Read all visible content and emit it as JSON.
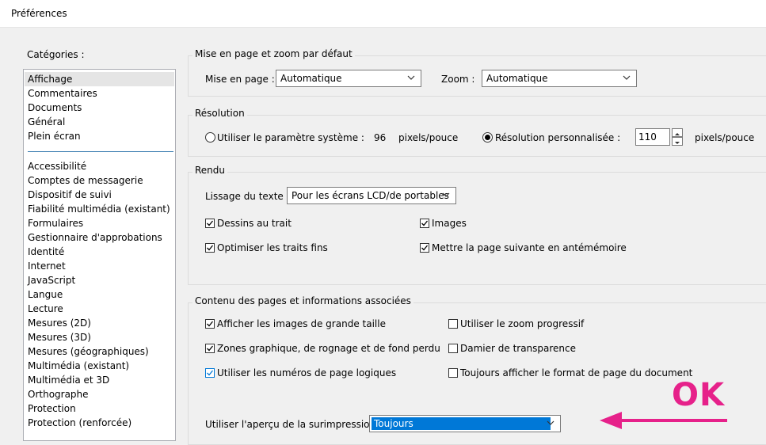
{
  "window": {
    "title": "Préférences"
  },
  "categories": {
    "label": "Catégories :",
    "top_items": [
      "Affichage",
      "Commentaires",
      "Documents",
      "Général",
      "Plein écran"
    ],
    "items": [
      "Accessibilité",
      "Comptes de messagerie",
      "Dispositif de suivi",
      "Fiabilité multimédia (existant)",
      "Formulaires",
      "Gestionnaire d'approbations",
      "Identité",
      "Internet",
      "JavaScript",
      "Langue",
      "Lecture",
      "Mesures (2D)",
      "Mesures (3D)",
      "Mesures (géographiques)",
      "Multimédia (existant)",
      "Multimédia et 3D",
      "Orthographe",
      "Protection",
      "Protection (renforcée)"
    ],
    "selected": "Affichage"
  },
  "layout_group": {
    "title": "Mise en page et zoom par défaut",
    "page_label": "Mise en page :",
    "page_value": "Automatique",
    "zoom_label": "Zoom :",
    "zoom_value": "Automatique"
  },
  "resolution": {
    "title": "Résolution",
    "system_label": "Utiliser le paramètre système :",
    "system_value": "96",
    "system_unit": "pixels/pouce",
    "custom_label": "Résolution personnalisée :",
    "custom_value": "110",
    "custom_unit": "pixels/pouce",
    "selected": "custom"
  },
  "rendering": {
    "title": "Rendu",
    "smoothing_label": "Lissage du texte :",
    "smoothing_value": "Pour les écrans LCD/de portables",
    "line_art": {
      "label": "Dessins au trait",
      "checked": true
    },
    "images": {
      "label": "Images",
      "checked": true
    },
    "thin_lines": {
      "label": "Optimiser les traits fins",
      "checked": true
    },
    "cache_page": {
      "label": "Mettre la page suivante en antémémoire",
      "checked": true
    }
  },
  "page_content": {
    "title": "Contenu des pages et informations associées",
    "large_images": {
      "label": "Afficher les images de grande taille",
      "checked": true
    },
    "smooth_zoom": {
      "label": "Utiliser le zoom progressif",
      "checked": false
    },
    "art_trim_bleed": {
      "label": "Zones graphique, de rognage et de fond perdu",
      "checked": true
    },
    "transparency_grid": {
      "label": "Damier de transparence",
      "checked": false
    },
    "logical_page_numbers": {
      "label": "Utiliser les numéros de page logiques",
      "checked": true
    },
    "always_doc_size": {
      "label": "Toujours afficher le format de page du document",
      "checked": false
    },
    "overprint_label": "Utiliser l'aperçu de la surimpression :",
    "overprint_value": "Toujours"
  },
  "annotation": {
    "text": "OK",
    "color": "#e6218a"
  },
  "colors": {
    "accent": "#0078d7",
    "annotation": "#e6218a"
  }
}
